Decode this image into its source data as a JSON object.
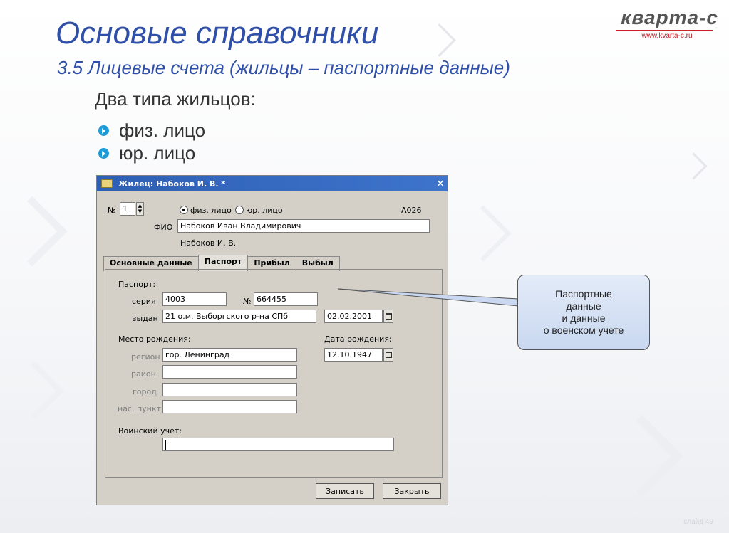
{
  "slide": {
    "title": "Основые справочники",
    "subtitle": "3.5  Лицевые счета (жильцы – паспортные данные)",
    "intro": "Два типа жильцов:",
    "bullets": [
      "физ. лицо",
      "юр. лицо"
    ],
    "slide_number": "слайд 49"
  },
  "logo": {
    "name": "кварта-с",
    "url": "www.kvarta-c.ru"
  },
  "window": {
    "title": "Жилец: Набоков И. В. *",
    "close": "✕",
    "number_label": "№",
    "number_value": "1",
    "radio_phys": "физ. лицо",
    "radio_jur": "юр. лицо",
    "code": "А026",
    "fio_label": "ФИО",
    "fio_value": "Набоков Иван Владимирович",
    "fio_short": "Набоков И. В.",
    "tabs": [
      "Основные данные",
      "Паспорт",
      "Прибыл",
      "Выбыл"
    ],
    "active_tab": "Паспорт",
    "passport": {
      "section": "Паспорт:",
      "series_label": "серия",
      "series_value": "4003",
      "num_label": "№",
      "num_value": "664455",
      "issued_label": "выдан",
      "issued_value": "21 о.м. Выборгского р-на СПб",
      "issued_date": "02.02.2001"
    },
    "birth": {
      "place_label": "Место рождения:",
      "date_label": "Дата рождения:",
      "region_label": "регион",
      "region_value": "гор. Ленинград",
      "date_value": "12.10.1947",
      "district_label": "район",
      "city_label": "город",
      "settlement_label": "нас. пункт"
    },
    "military": {
      "label": "Воинский учет:",
      "value": ""
    },
    "save_button": "Записать",
    "close_button": "Закрыть"
  },
  "callout": {
    "lines": [
      "Паспортные",
      "данные",
      "и данные",
      "о военском учете"
    ]
  }
}
